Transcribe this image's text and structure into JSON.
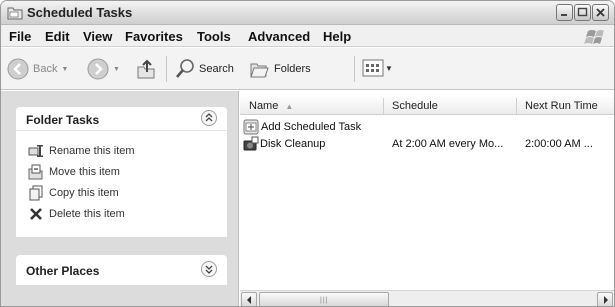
{
  "window": {
    "title": "Scheduled Tasks"
  },
  "menu": {
    "items": [
      "File",
      "Edit",
      "View",
      "Favorites",
      "Tools",
      "Advanced",
      "Help"
    ]
  },
  "toolbar": {
    "back_label": "Back",
    "search_label": "Search",
    "folders_label": "Folders"
  },
  "folder_tasks": {
    "title": "Folder Tasks",
    "items": [
      "Rename this item",
      "Move this item",
      "Copy this item",
      "Delete this item"
    ]
  },
  "other_places": {
    "title": "Other Places"
  },
  "list": {
    "columns": [
      "Name",
      "Schedule",
      "Next Run Time"
    ],
    "rows": [
      {
        "name": "Add Scheduled Task",
        "schedule": "",
        "next_run": ""
      },
      {
        "name": "Disk Cleanup",
        "schedule": "At 2:00 AM every Mo...",
        "next_run": "2:00:00 AM ..."
      }
    ]
  },
  "colors": {
    "accent": "#dcdcdc",
    "title_bar": "#dcdcdc"
  }
}
